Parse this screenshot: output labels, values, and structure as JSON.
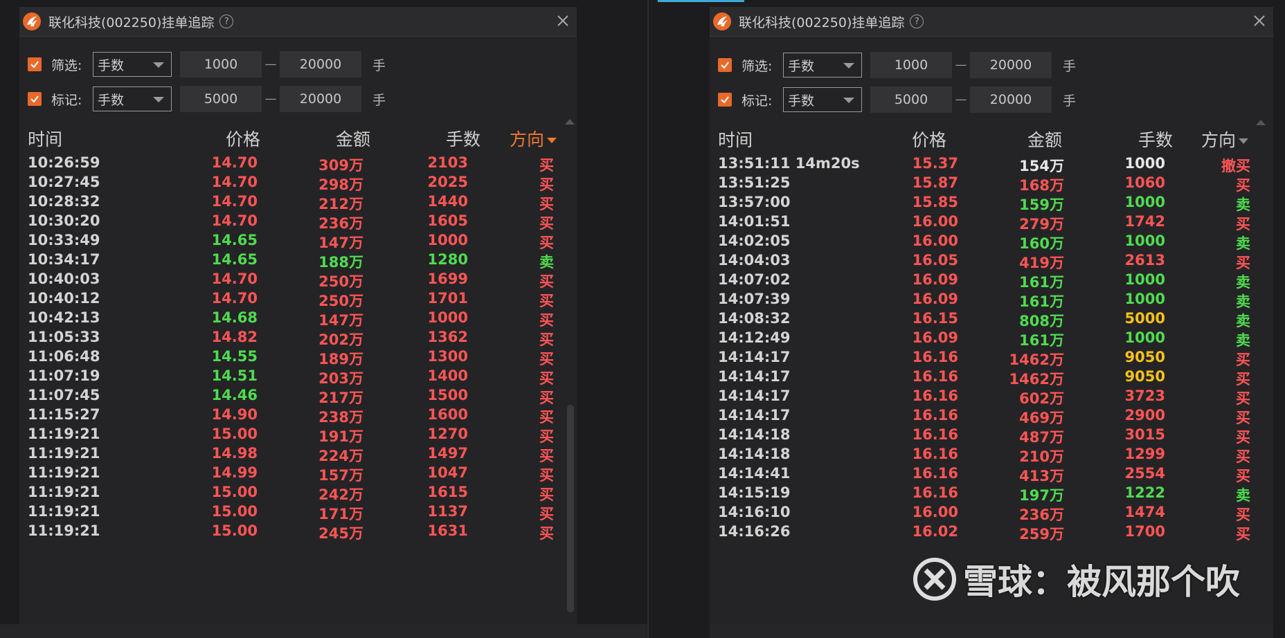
{
  "panels": [
    {
      "title": "联化科技(002250)挂单追踪",
      "help_symbol": "?",
      "filter": {
        "label": "筛选:",
        "select": "手数",
        "min": "1000",
        "max": "20000",
        "unit": "手",
        "dash": "—"
      },
      "mark": {
        "label": "标记:",
        "select": "手数",
        "min": "5000",
        "max": "20000",
        "unit": "手",
        "dash": "—"
      },
      "headers": {
        "time": "时间",
        "price": "价格",
        "amount": "金额",
        "lots": "手数",
        "direction": "方向"
      },
      "rows": [
        {
          "time": "10:26:59",
          "price": "14.70",
          "amount": "309万",
          "lots": "2103",
          "dir": "买",
          "pc": "red",
          "ac": "red",
          "lc": "red",
          "dc": "red"
        },
        {
          "time": "10:27:45",
          "price": "14.70",
          "amount": "298万",
          "lots": "2025",
          "dir": "买",
          "pc": "red",
          "ac": "red",
          "lc": "red",
          "dc": "red"
        },
        {
          "time": "10:28:32",
          "price": "14.70",
          "amount": "212万",
          "lots": "1440",
          "dir": "买",
          "pc": "red",
          "ac": "red",
          "lc": "red",
          "dc": "red"
        },
        {
          "time": "10:30:20",
          "price": "14.70",
          "amount": "236万",
          "lots": "1605",
          "dir": "买",
          "pc": "red",
          "ac": "red",
          "lc": "red",
          "dc": "red"
        },
        {
          "time": "10:33:49",
          "price": "14.65",
          "amount": "147万",
          "lots": "1000",
          "dir": "买",
          "pc": "green",
          "ac": "red",
          "lc": "red",
          "dc": "red"
        },
        {
          "time": "10:34:17",
          "price": "14.65",
          "amount": "188万",
          "lots": "1280",
          "dir": "卖",
          "pc": "green",
          "ac": "green",
          "lc": "green",
          "dc": "green"
        },
        {
          "time": "10:40:03",
          "price": "14.70",
          "amount": "250万",
          "lots": "1699",
          "dir": "买",
          "pc": "red",
          "ac": "red",
          "lc": "red",
          "dc": "red"
        },
        {
          "time": "10:40:12",
          "price": "14.70",
          "amount": "250万",
          "lots": "1701",
          "dir": "买",
          "pc": "red",
          "ac": "red",
          "lc": "red",
          "dc": "red"
        },
        {
          "time": "10:42:13",
          "price": "14.68",
          "amount": "147万",
          "lots": "1000",
          "dir": "买",
          "pc": "green",
          "ac": "red",
          "lc": "red",
          "dc": "red"
        },
        {
          "time": "11:05:33",
          "price": "14.82",
          "amount": "202万",
          "lots": "1362",
          "dir": "买",
          "pc": "red",
          "ac": "red",
          "lc": "red",
          "dc": "red"
        },
        {
          "time": "11:06:48",
          "price": "14.55",
          "amount": "189万",
          "lots": "1300",
          "dir": "买",
          "pc": "green",
          "ac": "red",
          "lc": "red",
          "dc": "red"
        },
        {
          "time": "11:07:19",
          "price": "14.51",
          "amount": "203万",
          "lots": "1400",
          "dir": "买",
          "pc": "green",
          "ac": "red",
          "lc": "red",
          "dc": "red"
        },
        {
          "time": "11:07:45",
          "price": "14.46",
          "amount": "217万",
          "lots": "1500",
          "dir": "买",
          "pc": "green",
          "ac": "red",
          "lc": "red",
          "dc": "red"
        },
        {
          "time": "11:15:27",
          "price": "14.90",
          "amount": "238万",
          "lots": "1600",
          "dir": "买",
          "pc": "red",
          "ac": "red",
          "lc": "red",
          "dc": "red"
        },
        {
          "time": "11:19:21",
          "price": "15.00",
          "amount": "191万",
          "lots": "1270",
          "dir": "买",
          "pc": "red",
          "ac": "red",
          "lc": "red",
          "dc": "red"
        },
        {
          "time": "11:19:21",
          "price": "14.98",
          "amount": "224万",
          "lots": "1497",
          "dir": "买",
          "pc": "red",
          "ac": "red",
          "lc": "red",
          "dc": "red"
        },
        {
          "time": "11:19:21",
          "price": "14.99",
          "amount": "157万",
          "lots": "1047",
          "dir": "买",
          "pc": "red",
          "ac": "red",
          "lc": "red",
          "dc": "red"
        },
        {
          "time": "11:19:21",
          "price": "15.00",
          "amount": "242万",
          "lots": "1615",
          "dir": "买",
          "pc": "red",
          "ac": "red",
          "lc": "red",
          "dc": "red"
        },
        {
          "time": "11:19:21",
          "price": "15.00",
          "amount": "171万",
          "lots": "1137",
          "dir": "买",
          "pc": "red",
          "ac": "red",
          "lc": "red",
          "dc": "red"
        },
        {
          "time": "11:19:21",
          "price": "15.00",
          "amount": "245万",
          "lots": "1631",
          "dir": "买",
          "pc": "red",
          "ac": "red",
          "lc": "red",
          "dc": "red"
        }
      ]
    },
    {
      "title": "联化科技(002250)挂单追踪",
      "help_symbol": "?",
      "filter": {
        "label": "筛选:",
        "select": "手数",
        "min": "1000",
        "max": "20000",
        "unit": "手",
        "dash": "—"
      },
      "mark": {
        "label": "标记:",
        "select": "手数",
        "min": "5000",
        "max": "20000",
        "unit": "手",
        "dash": "—"
      },
      "headers": {
        "time": "时间",
        "price": "价格",
        "amount": "金额",
        "lots": "手数",
        "direction": "方向"
      },
      "rows": [
        {
          "time": "13:51:11 14m20s",
          "price": "15.37",
          "amount": "154万",
          "lots": "1000",
          "dir": "撤买",
          "pc": "red",
          "ac": "white",
          "lc": "white",
          "dc": "red"
        },
        {
          "time": "13:51:25",
          "price": "15.87",
          "amount": "168万",
          "lots": "1060",
          "dir": "买",
          "pc": "red",
          "ac": "red",
          "lc": "red",
          "dc": "red"
        },
        {
          "time": "13:57:00",
          "price": "15.85",
          "amount": "159万",
          "lots": "1000",
          "dir": "卖",
          "pc": "red",
          "ac": "green",
          "lc": "green",
          "dc": "green"
        },
        {
          "time": "14:01:51",
          "price": "16.00",
          "amount": "279万",
          "lots": "1742",
          "dir": "买",
          "pc": "red",
          "ac": "red",
          "lc": "red",
          "dc": "red"
        },
        {
          "time": "14:02:05",
          "price": "16.00",
          "amount": "160万",
          "lots": "1000",
          "dir": "卖",
          "pc": "red",
          "ac": "green",
          "lc": "green",
          "dc": "green"
        },
        {
          "time": "14:04:03",
          "price": "16.05",
          "amount": "419万",
          "lots": "2613",
          "dir": "买",
          "pc": "red",
          "ac": "red",
          "lc": "red",
          "dc": "red"
        },
        {
          "time": "14:07:02",
          "price": "16.09",
          "amount": "161万",
          "lots": "1000",
          "dir": "卖",
          "pc": "red",
          "ac": "green",
          "lc": "green",
          "dc": "green"
        },
        {
          "time": "14:07:39",
          "price": "16.09",
          "amount": "161万",
          "lots": "1000",
          "dir": "卖",
          "pc": "red",
          "ac": "green",
          "lc": "green",
          "dc": "green"
        },
        {
          "time": "14:08:32",
          "price": "16.15",
          "amount": "808万",
          "lots": "5000",
          "dir": "卖",
          "pc": "red",
          "ac": "green",
          "lc": "yellow",
          "dc": "green"
        },
        {
          "time": "14:12:49",
          "price": "16.09",
          "amount": "161万",
          "lots": "1000",
          "dir": "卖",
          "pc": "red",
          "ac": "green",
          "lc": "green",
          "dc": "green"
        },
        {
          "time": "14:14:17",
          "price": "16.16",
          "amount": "1462万",
          "lots": "9050",
          "dir": "买",
          "pc": "red",
          "ac": "red",
          "lc": "yellow",
          "dc": "red"
        },
        {
          "time": "14:14:17",
          "price": "16.16",
          "amount": "1462万",
          "lots": "9050",
          "dir": "买",
          "pc": "red",
          "ac": "red",
          "lc": "yellow",
          "dc": "red"
        },
        {
          "time": "14:14:17",
          "price": "16.16",
          "amount": "602万",
          "lots": "3723",
          "dir": "买",
          "pc": "red",
          "ac": "red",
          "lc": "red",
          "dc": "red"
        },
        {
          "time": "14:14:17",
          "price": "16.16",
          "amount": "469万",
          "lots": "2900",
          "dir": "买",
          "pc": "red",
          "ac": "red",
          "lc": "red",
          "dc": "red"
        },
        {
          "time": "14:14:18",
          "price": "16.16",
          "amount": "487万",
          "lots": "3015",
          "dir": "买",
          "pc": "red",
          "ac": "red",
          "lc": "red",
          "dc": "red"
        },
        {
          "time": "14:14:18",
          "price": "16.16",
          "amount": "210万",
          "lots": "1299",
          "dir": "买",
          "pc": "red",
          "ac": "red",
          "lc": "red",
          "dc": "red"
        },
        {
          "time": "14:14:41",
          "price": "16.16",
          "amount": "413万",
          "lots": "2554",
          "dir": "买",
          "pc": "red",
          "ac": "red",
          "lc": "red",
          "dc": "red"
        },
        {
          "time": "14:15:19",
          "price": "16.16",
          "amount": "197万",
          "lots": "1222",
          "dir": "卖",
          "pc": "red",
          "ac": "green",
          "lc": "green",
          "dc": "green"
        },
        {
          "time": "14:16:10",
          "price": "16.00",
          "amount": "236万",
          "lots": "1474",
          "dir": "买",
          "pc": "red",
          "ac": "red",
          "lc": "red",
          "dc": "red"
        },
        {
          "time": "14:16:26",
          "price": "16.02",
          "amount": "259万",
          "lots": "1700",
          "dir": "买",
          "pc": "red",
          "ac": "red",
          "lc": "red",
          "dc": "red"
        }
      ]
    }
  ],
  "watermark": "雪球：被风那个吹",
  "colors": {
    "accent": "#e8692a",
    "buy": "#ff5555",
    "sell": "#4fdc4f",
    "mark": "#f5c21a"
  }
}
